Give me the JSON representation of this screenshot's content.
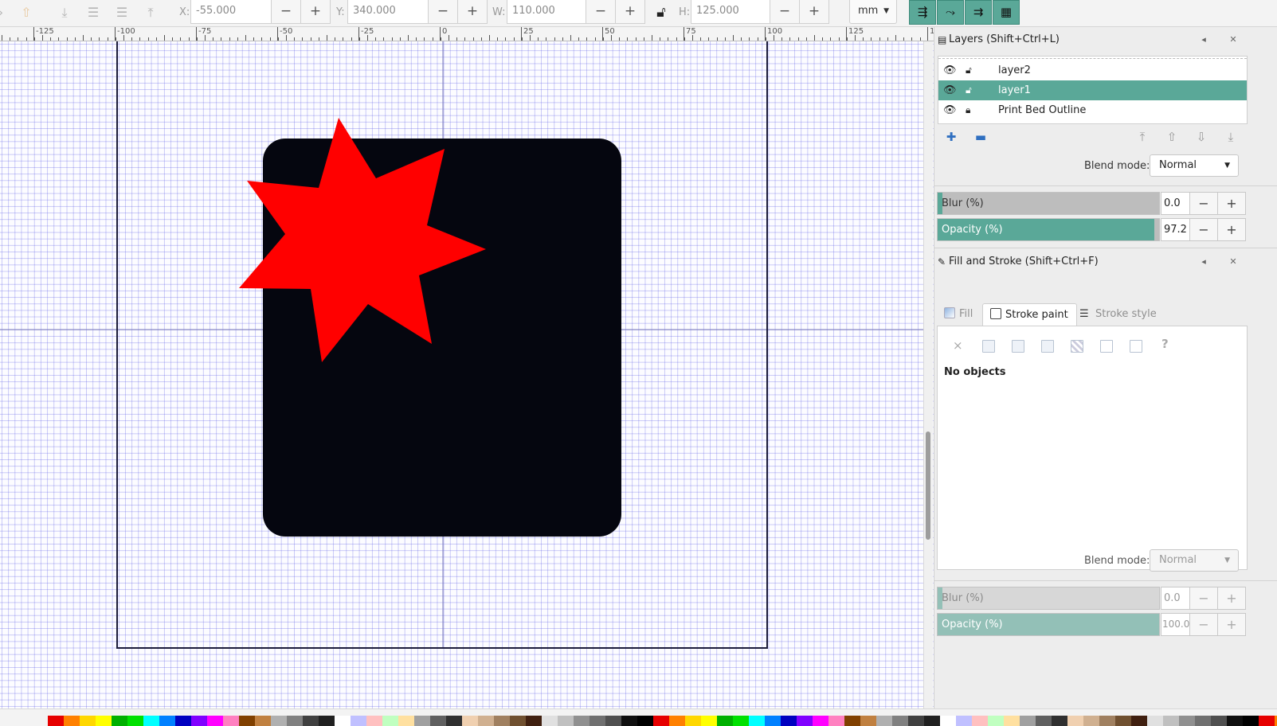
{
  "toolbar": {
    "x_label": "X:",
    "x_value": "-55.000",
    "y_label": "Y:",
    "y_value": "340.000",
    "w_label": "W:",
    "w_value": "110.000",
    "h_label": "H:",
    "h_value": "125.000",
    "minus": "−",
    "plus": "+",
    "unit": "mm"
  },
  "ruler": {
    "labels": [
      "-125",
      "-100",
      "-75",
      "-50",
      "-25",
      "0",
      "25",
      "50",
      "75",
      "100",
      "125",
      "1"
    ]
  },
  "layers_panel": {
    "title": "Layers (Shift+Ctrl+L)",
    "layers": [
      {
        "name": "layer2",
        "selected": false
      },
      {
        "name": "layer1",
        "selected": true
      },
      {
        "name": "Print Bed Outline",
        "selected": false
      }
    ],
    "blend_label": "Blend mode:",
    "blend_value": "Normal",
    "blur_label": "Blur (%)",
    "blur_value": "0.0",
    "opacity_label": "Opacity (%)",
    "opacity_value": "97.2"
  },
  "fill_stroke_panel": {
    "title": "Fill and Stroke (Shift+Ctrl+F)",
    "tabs": [
      "Fill",
      "Stroke paint",
      "Stroke style"
    ],
    "active_tab": "Stroke paint",
    "no_objects": "No objects",
    "unset_icon": "×",
    "unknown_icon": "?",
    "blend_label": "Blend mode:",
    "blend_value": "Normal",
    "blur_label": "Blur (%)",
    "blur_value": "0.0",
    "opacity_label": "Opacity (%)",
    "opacity_value": "100.0"
  },
  "canvas": {
    "rect_fill": "#05060f",
    "star_fill": "#ff0000",
    "page_border": "#1b1b3a"
  },
  "accent": "#5aa898",
  "palette": [
    "#e60000",
    "#ff8000",
    "#ffd700",
    "#ffff00",
    "#00b000",
    "#00e000",
    "#00ffff",
    "#0080ff",
    "#0000c0",
    "#8000ff",
    "#ff00ff",
    "#ff80c0",
    "#804000",
    "#c08040",
    "#b0b0b0",
    "#808080",
    "#404040",
    "#202020",
    "#ffffff",
    "#c0c0ff",
    "#ffc0c0",
    "#c0ffc0",
    "#ffe0a0",
    "#a0a0a0",
    "#606060",
    "#303030",
    "#f0d0b0",
    "#d0b090",
    "#a08060",
    "#705030",
    "#402010",
    "#e0e0e0",
    "#c0c0c0",
    "#909090",
    "#707070",
    "#505050",
    "#101010",
    "#000000"
  ]
}
